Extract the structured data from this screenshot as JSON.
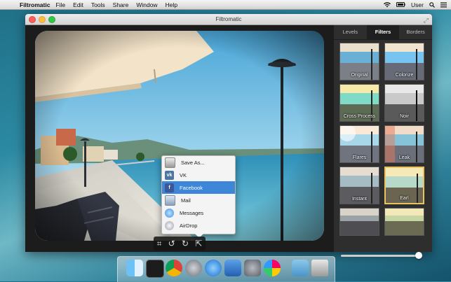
{
  "menubar": {
    "app_name": "Filtromatic",
    "items": [
      "File",
      "Edit",
      "Tools",
      "Share",
      "Window",
      "Help"
    ],
    "user": "User"
  },
  "window": {
    "title": "Filtromatic"
  },
  "sidebar": {
    "tabs": [
      "Levels",
      "Filters",
      "Borders"
    ],
    "active_tab": "Filters",
    "filters": [
      {
        "label": "Original"
      },
      {
        "label": "Colorize"
      },
      {
        "label": "Cross Process"
      },
      {
        "label": "Noir"
      },
      {
        "label": "Flares"
      },
      {
        "label": "Leak"
      },
      {
        "label": "Instant"
      },
      {
        "label": "Earl"
      },
      {
        "label": ""
      },
      {
        "label": ""
      }
    ],
    "selected_filter": "Earl",
    "intensity": 1.0
  },
  "share_menu": {
    "items": [
      {
        "label": "Save As...",
        "icon": "save-icon"
      },
      {
        "label": "VK",
        "icon": "vk-icon"
      },
      {
        "label": "Facebook",
        "icon": "facebook-icon"
      },
      {
        "label": "Mail",
        "icon": "mail-icon"
      },
      {
        "label": "Messages",
        "icon": "messages-icon"
      },
      {
        "label": "AirDrop",
        "icon": "airdrop-icon"
      }
    ],
    "selected": "Facebook"
  },
  "photo_tools": [
    "crop-icon",
    "rotate-left-icon",
    "rotate-right-icon",
    "share-icon"
  ],
  "dock": [
    "finder-icon",
    "terminal-icon",
    "chrome-icon",
    "rocket-icon",
    "itunes-icon",
    "xcode-icon",
    "system-preferences-icon",
    "filtromatic-icon",
    "downloads-folder-icon",
    "trash-icon"
  ]
}
